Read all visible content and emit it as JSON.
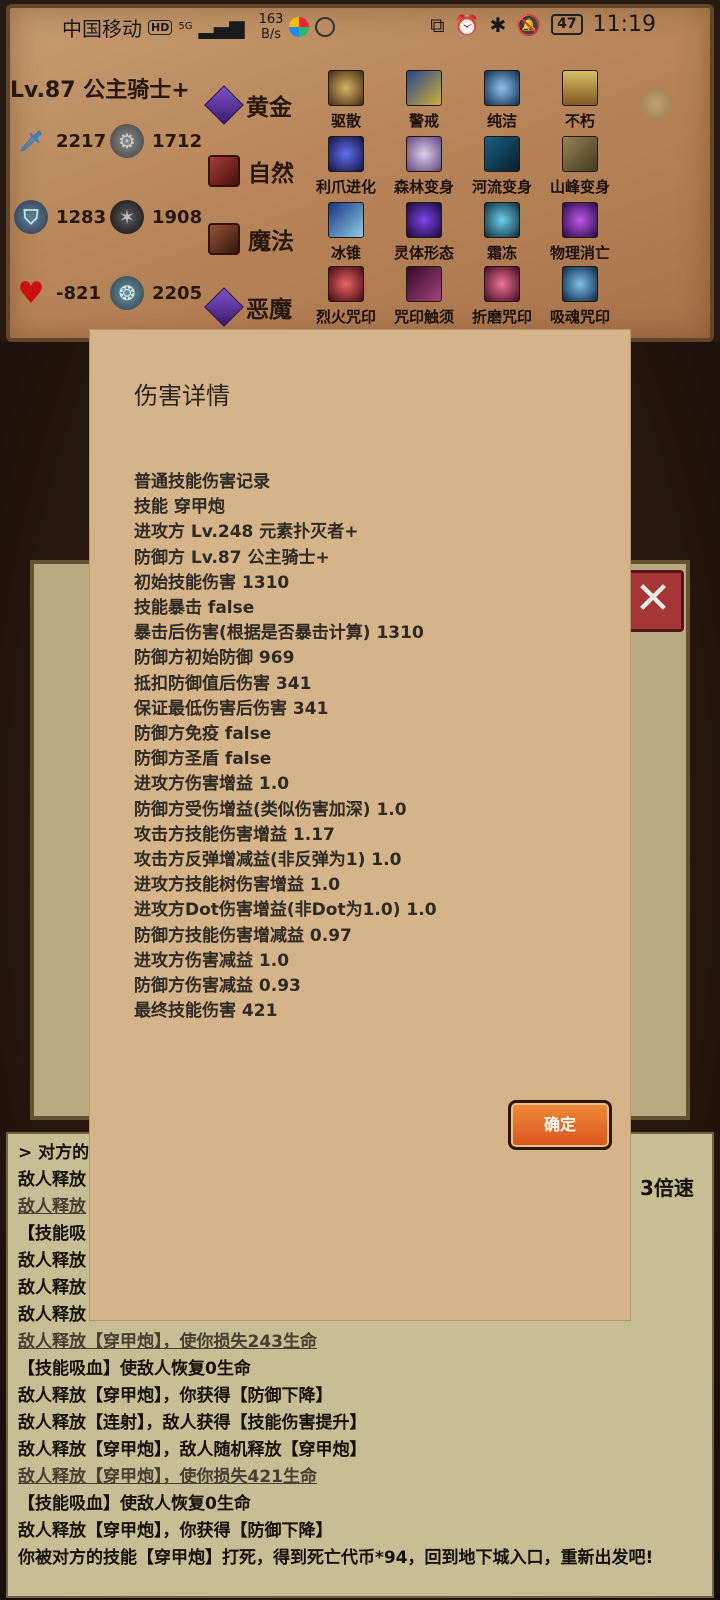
{
  "status_bar": {
    "carrier": "中国移动",
    "hd": "HD",
    "network": "5G",
    "speed_value": "163",
    "speed_unit": "B/s",
    "battery": "47",
    "time": "11:19"
  },
  "character": {
    "level_name": "Lv.87 公主骑士+",
    "stats": {
      "attack": "2217",
      "attack2": "1712",
      "defense": "1283",
      "defense2": "1908",
      "hp": "-821",
      "hp2": "2205"
    },
    "attributes": [
      "黄金",
      "自然",
      "魔法",
      "恶魔"
    ]
  },
  "skills": [
    "驱散",
    "警戒",
    "纯洁",
    "不朽",
    "利爪进化",
    "森林变身",
    "河流变身",
    "山峰变身",
    "冰锥",
    "灵体形态",
    "霜冻",
    "物理消亡",
    "烈火咒印",
    "咒印触须",
    "折磨咒印",
    "吸魂咒印"
  ],
  "log": {
    "lines": [
      "> 对方的",
      "敌人释放",
      "敌人释放",
      "【技能吸",
      "敌人释放",
      "敌人释放",
      "敌人释放",
      "敌人释放【穿甲炮】，使你损失243生命",
      "【技能吸血】使敌人恢复0生命",
      "敌人释放【穿甲炮】，你获得【防御下降】",
      "敌人释放【连射】，敌人获得【技能伤害提升】",
      "敌人释放【穿甲炮】，敌人随机释放【穿甲炮】",
      "敌人释放【穿甲炮】，使你损失421生命",
      "【技能吸血】使敌人恢复0生命",
      "敌人释放【穿甲炮】，你获得【防御下降】",
      "你被对方的技能【穿甲炮】打死，得到死亡代币*94，回到地下城入口，重新出发吧!"
    ],
    "speed": "3倍速"
  },
  "dialog": {
    "title": "伤害详情",
    "lines": [
      "普通技能伤害记录",
      "技能 穿甲炮",
      "进攻方 Lv.248 元素扑灭者+",
      "防御方 Lv.87 公主骑士+",
      "初始技能伤害 1310",
      "技能暴击 false",
      "暴击后伤害(根据是否暴击计算) 1310",
      "防御方初始防御 969",
      "抵扣防御值后伤害 341",
      "保证最低伤害后伤害 341",
      "防御方免疫 false",
      "防御方圣盾 false",
      "进攻方伤害增益 1.0",
      "防御方受伤增益(类似伤害加深) 1.0",
      "攻击方技能伤害增益 1.17",
      "攻击方反弹增减益(非反弹为1) 1.0",
      "进攻方技能树伤害增益 1.0",
      "进攻方Dot伤害增益(非Dot为1.0) 1.0",
      "防御方技能伤害增减益 0.97",
      "进攻方伤害减益 1.0",
      "防御方伤害减益 0.93",
      "最终技能伤害 421"
    ],
    "ok_label": "确定"
  }
}
